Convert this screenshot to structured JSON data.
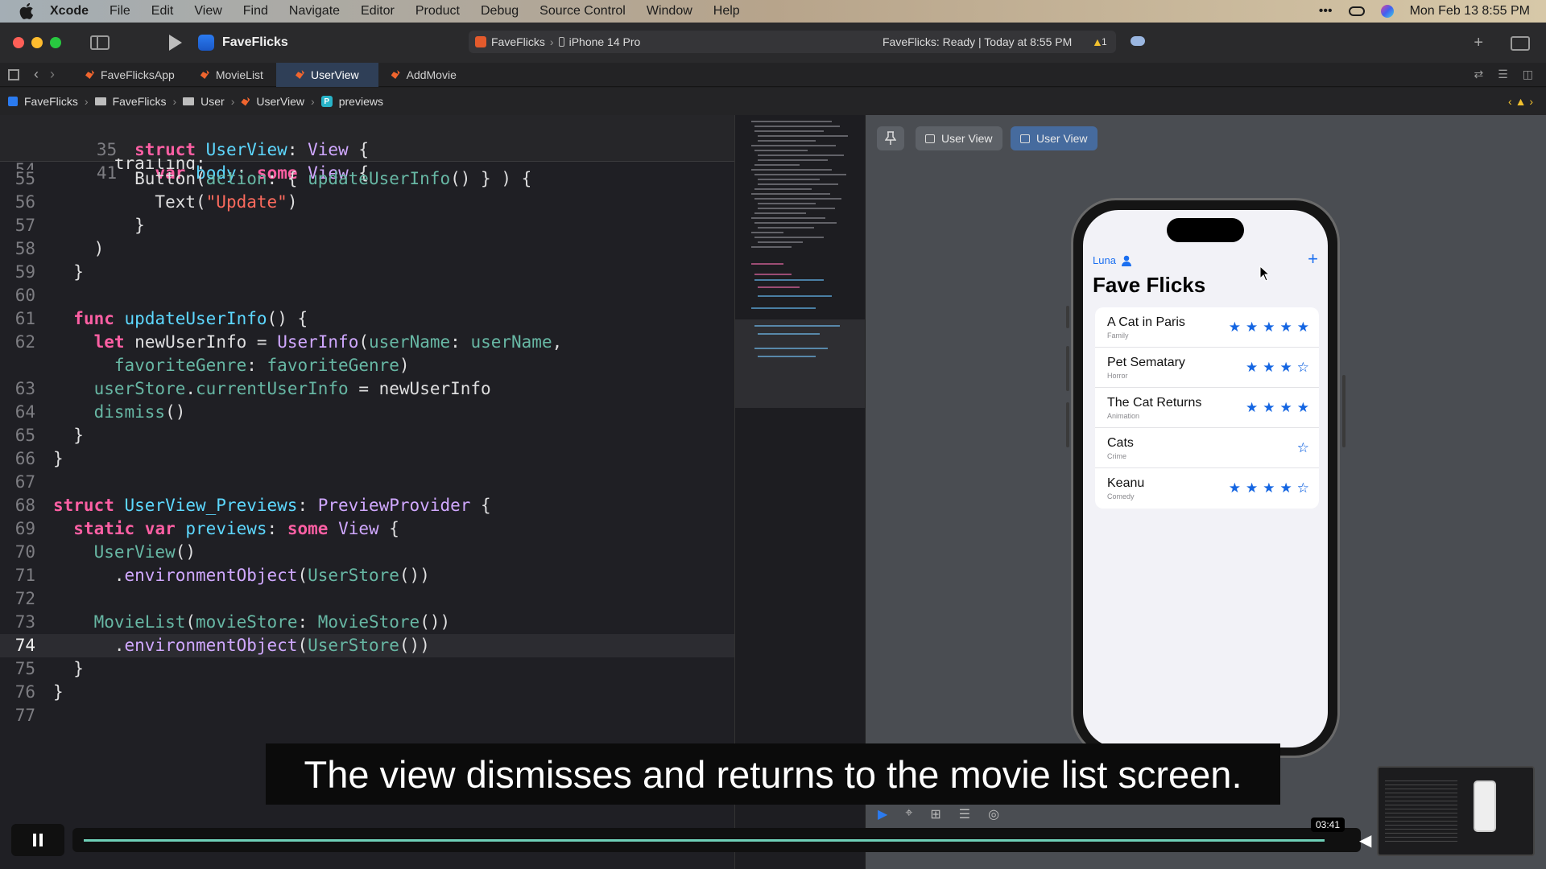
{
  "menubar": {
    "app": "Xcode",
    "items": [
      "File",
      "Edit",
      "View",
      "Find",
      "Navigate",
      "Editor",
      "Product",
      "Debug",
      "Source Control",
      "Window",
      "Help"
    ],
    "clock": "Mon Feb 13  8:55 PM"
  },
  "toolbar": {
    "project": "FaveFlicks",
    "scheme": "FaveFlicks",
    "device": "iPhone 14 Pro",
    "status": "FaveFlicks: Ready | Today at 8:55 PM",
    "warnings": "1"
  },
  "tabs": [
    "FaveFlicksApp",
    "MovieList",
    "UserView",
    "AddMovie"
  ],
  "breadcrumb": [
    "FaveFlicks",
    "FaveFlicks",
    "User",
    "UserView",
    "previews"
  ],
  "code": {
    "pinned": [
      {
        "n": "35",
        "text": "struct UserView: View {"
      },
      {
        "n": "41",
        "text": "  var body: some View {"
      }
    ],
    "lines": [
      {
        "n": "54",
        "text": "      trailing:"
      },
      {
        "n": "55",
        "text": "        Button(action: { updateUserInfo() } ) {"
      },
      {
        "n": "56",
        "text": "          Text(\"Update\")"
      },
      {
        "n": "57",
        "text": "        }"
      },
      {
        "n": "58",
        "text": "    )"
      },
      {
        "n": "59",
        "text": "  }"
      },
      {
        "n": "60",
        "text": ""
      },
      {
        "n": "61",
        "text": "  func updateUserInfo() {"
      },
      {
        "n": "62",
        "text": "    let newUserInfo = UserInfo(userName: userName,"
      },
      {
        "n": "",
        "text": "      favoriteGenre: favoriteGenre)"
      },
      {
        "n": "63",
        "text": "    userStore.currentUserInfo = newUserInfo"
      },
      {
        "n": "64",
        "text": "    dismiss()"
      },
      {
        "n": "65",
        "text": "  }"
      },
      {
        "n": "66",
        "text": "}"
      },
      {
        "n": "67",
        "text": ""
      },
      {
        "n": "68",
        "text": "struct UserView_Previews: PreviewProvider {"
      },
      {
        "n": "69",
        "text": "  static var previews: some View {"
      },
      {
        "n": "70",
        "text": "    UserView()"
      },
      {
        "n": "71",
        "text": "      .environmentObject(UserStore())"
      },
      {
        "n": "72",
        "text": ""
      },
      {
        "n": "73",
        "text": "    MovieList(movieStore: MovieStore())"
      },
      {
        "n": "74",
        "text": "      .environmentObject(UserStore())"
      },
      {
        "n": "75",
        "text": "  }"
      },
      {
        "n": "76",
        "text": "}"
      },
      {
        "n": "77",
        "text": ""
      }
    ]
  },
  "preview": {
    "variant_1": "User View",
    "variant_2": "User View",
    "user": "Luna",
    "title": "Fave Flicks",
    "movies": [
      {
        "title": "A Cat in Paris",
        "genre": "Family",
        "rating": 5
      },
      {
        "title": "Pet Sematary",
        "genre": "Horror",
        "rating": 3.5
      },
      {
        "title": "The Cat Returns",
        "genre": "Animation",
        "rating": 4
      },
      {
        "title": "Cats",
        "genre": "Crime",
        "rating": 0.5
      },
      {
        "title": "Keanu",
        "genre": "Comedy",
        "rating": 4.5
      }
    ]
  },
  "caption": "The view dismisses and returns to the movie list screen.",
  "player": {
    "time": "03:41",
    "progress": 0.98
  },
  "colors": {
    "accent": "#1b6ff0",
    "star": "#1465e2"
  }
}
